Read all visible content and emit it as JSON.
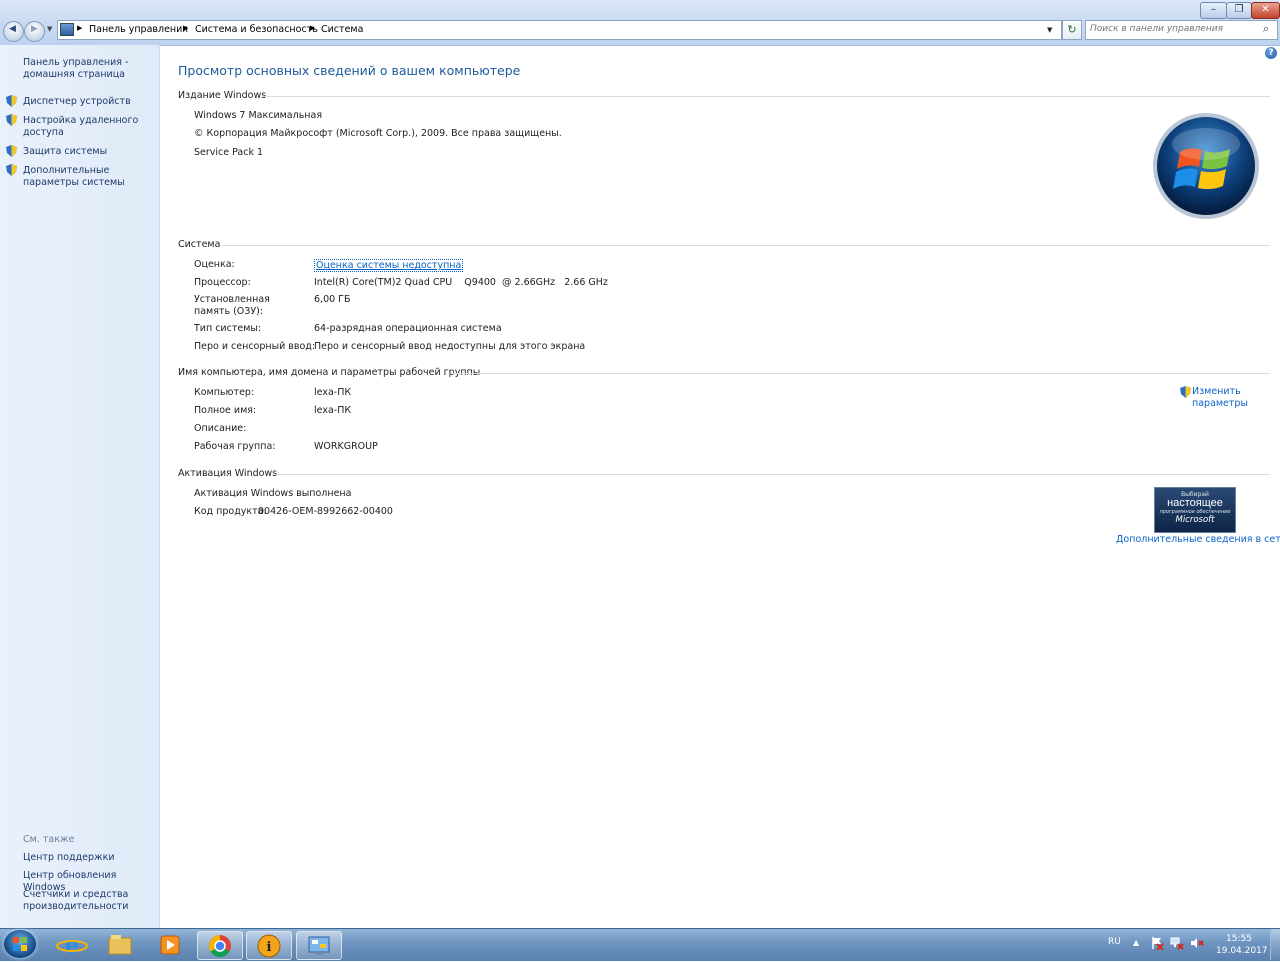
{
  "breadcrumb": [
    "Панель управления",
    "Система и безопасность",
    "Система"
  ],
  "search": {
    "placeholder": "Поиск в панели управления"
  },
  "sidebar": {
    "home": "Панель управления - домашняя страница",
    "items": [
      {
        "label": "Диспетчер устройств"
      },
      {
        "label": "Настройка удаленного доступа"
      },
      {
        "label": "Защита системы"
      },
      {
        "label": "Дополнительные параметры системы"
      }
    ],
    "see_also_title": "См. также",
    "see_also": [
      "Центр поддержки",
      "Центр обновления Windows",
      "Счетчики и средства производительности"
    ]
  },
  "page_title": "Просмотр основных сведений о вашем компьютере",
  "edition": {
    "title": "Издание Windows",
    "name": "Windows 7 Максимальная",
    "copyright": "© Корпорация Майкрософт (Microsoft Corp.), 2009. Все права защищены.",
    "service_pack": "Service Pack 1"
  },
  "system": {
    "title": "Система",
    "rows": [
      {
        "label": "Оценка:",
        "value": "Оценка системы недоступна"
      },
      {
        "label": "Процессор:",
        "value": "Intel(R) Core(TM)2 Quad CPU    Q9400  @ 2.66GHz   2.66 GHz"
      },
      {
        "label": "Установленная память (ОЗУ):",
        "value": "6,00 ГБ"
      },
      {
        "label": "Тип системы:",
        "value": "64-разрядная операционная система"
      },
      {
        "label": "Перо и сенсорный ввод:",
        "value": "Перо и сенсорный ввод недоступны для этого экрана"
      }
    ]
  },
  "computer": {
    "title": "Имя компьютера, имя домена и параметры рабочей группы",
    "change_label": "Изменить параметры",
    "rows": [
      {
        "label": "Компьютер:",
        "value": "lexa-ПК"
      },
      {
        "label": "Полное имя:",
        "value": "lexa-ПК"
      },
      {
        "label": "Описание:",
        "value": ""
      },
      {
        "label": "Рабочая группа:",
        "value": "WORKGROUP"
      }
    ]
  },
  "activation": {
    "title": "Активация Windows",
    "status": "Активация Windows выполнена",
    "product_key_label": "Код продукта:",
    "product_key": "00426-OEM-8992662-00400",
    "badge_line1": "Выбирай",
    "badge_line2": "настоящее",
    "badge_line3": "программное обеспечение",
    "badge_line4": "Microsoft",
    "more_info": "Дополнительные сведения в сети..."
  },
  "taskbar": {
    "language": "RU",
    "time": "15:55",
    "date": "19.04.2017"
  },
  "colors": {
    "accent": "#1e5b9c",
    "link": "#0a64c8",
    "taskbar": "#6d93bf"
  }
}
